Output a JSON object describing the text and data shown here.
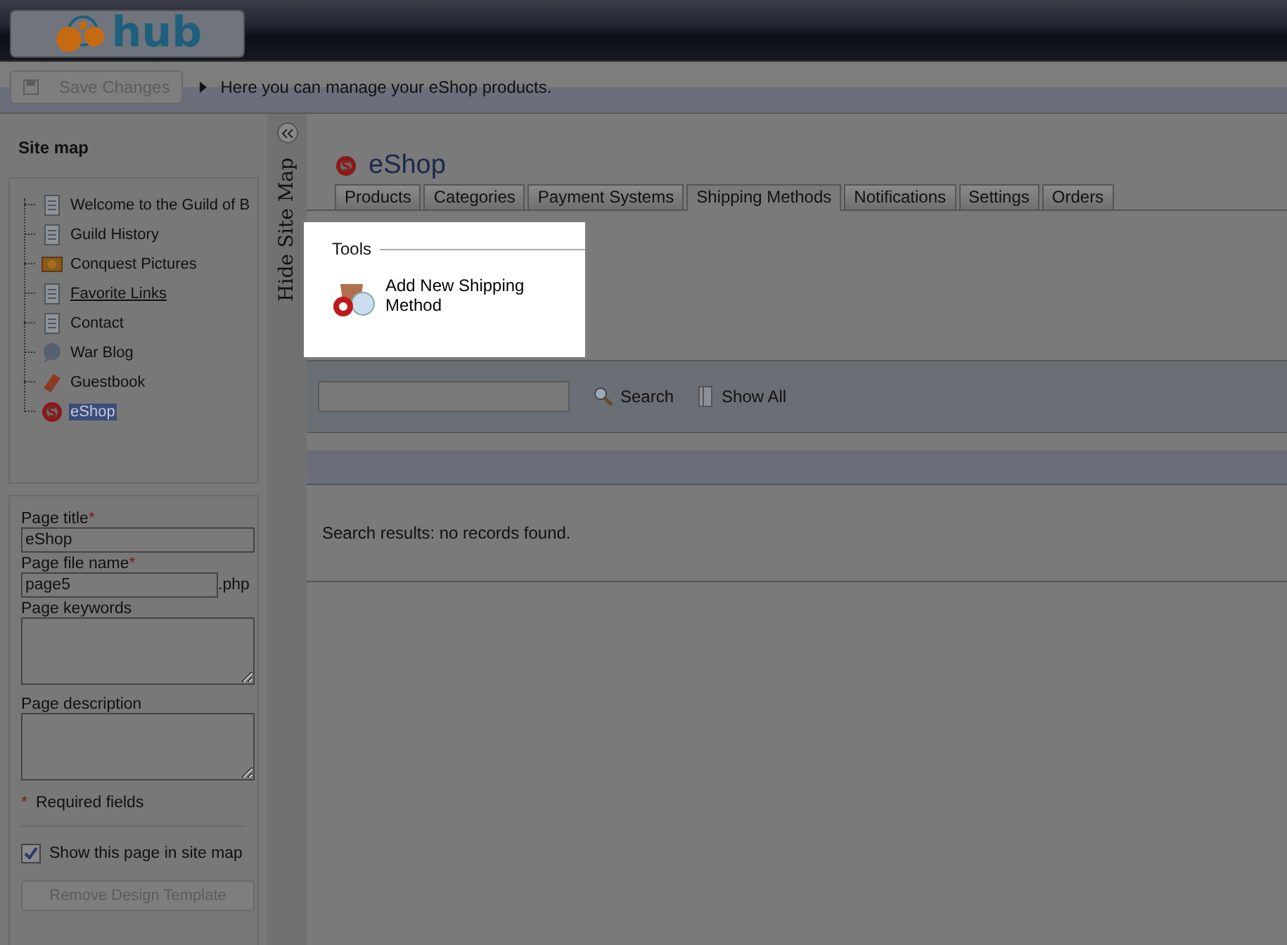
{
  "logo": {
    "text": "hub"
  },
  "toolbar": {
    "save_button": {
      "label": "Save Changes",
      "disabled": true
    },
    "hint": "Here you can manage your eShop products."
  },
  "sidebar": {
    "title": "Site map",
    "items": [
      {
        "label": "Welcome to the Guild of B",
        "kind": "page",
        "selected": false,
        "underlined": false
      },
      {
        "label": "Guild History",
        "kind": "page",
        "selected": false,
        "underlined": false
      },
      {
        "label": "Conquest Pictures",
        "kind": "gallery",
        "selected": false,
        "underlined": false
      },
      {
        "label": "Favorite Links",
        "kind": "page",
        "selected": false,
        "underlined": true
      },
      {
        "label": "Contact",
        "kind": "page",
        "selected": false,
        "underlined": false
      },
      {
        "label": "War Blog",
        "kind": "blog",
        "selected": false,
        "underlined": false
      },
      {
        "label": "Guestbook",
        "kind": "book",
        "selected": false,
        "underlined": false
      },
      {
        "label": "eShop",
        "kind": "shop",
        "selected": true,
        "underlined": false
      }
    ],
    "hide_label": "Hide Site Map"
  },
  "form": {
    "fields": [
      {
        "label": "Page title",
        "required": true,
        "kind": "text",
        "value": "eShop"
      },
      {
        "label": "Page file name",
        "required": true,
        "kind": "file",
        "value": "page5",
        "suffix": ".php"
      },
      {
        "label": "Page keywords",
        "required": false,
        "kind": "area"
      },
      {
        "label": "Page description",
        "required": false,
        "kind": "area"
      }
    ],
    "required_mark": "*",
    "required_note": "Required fields",
    "show_in_map": {
      "label": "Show this page in site map",
      "checked": true
    },
    "remove_button": "Remove Design Template"
  },
  "page": {
    "title": "eShop",
    "tabs": [
      {
        "label": "Products",
        "selected": false
      },
      {
        "label": "Categories",
        "selected": false
      },
      {
        "label": "Payment Systems",
        "selected": false
      },
      {
        "label": "Shipping Methods",
        "selected": true
      },
      {
        "label": "Notifications",
        "selected": false
      },
      {
        "label": "Settings",
        "selected": false
      },
      {
        "label": "Orders",
        "selected": false
      }
    ],
    "tools": {
      "title": "Tools",
      "items": [
        "Add New Shipping Method"
      ]
    },
    "search": {
      "button": "Search",
      "show_all": "Show All"
    },
    "results": "Search results: no records found."
  }
}
